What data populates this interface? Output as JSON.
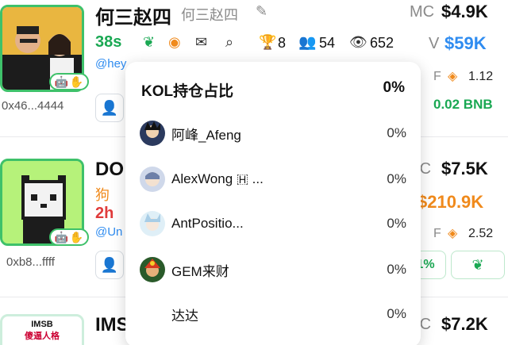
{
  "row1": {
    "name": "何三赵四",
    "name_secondary": "何三赵四",
    "age": "38s",
    "stat_trophy": "8",
    "stat_holders": "54",
    "stat_views": "652",
    "handle": "@hey",
    "addr": "0x46...4444",
    "mc_label": "MC",
    "mc_value": "$4.9K",
    "v_label": "V",
    "v_value": "$59K",
    "f_label": "F",
    "f_value": "1.12",
    "bnb_value": "0.02 BNB"
  },
  "row2": {
    "name": "DO",
    "subname": "狗",
    "age": "2h",
    "handle": "@Un",
    "addr": "0xb8...ffff",
    "mc_label": "MC",
    "mc_value": "$7.5K",
    "v_value": "$210.9K",
    "f_label": "F",
    "f_value": "2.52",
    "pct_value": "1%"
  },
  "row3": {
    "name": "IMS",
    "avatar_text_top": "IMSB",
    "avatar_text_bottom": "傻逼人格",
    "mc_label": "MC",
    "mc_value": "$7.2K"
  },
  "popup": {
    "title": "KOL持仓占比",
    "title_pct": "0%",
    "rows": [
      {
        "name": "阿峰_Afeng",
        "pct": "0%"
      },
      {
        "name": "AlexWong 🇭 ...",
        "pct": "0%"
      },
      {
        "name": "AntPositio...",
        "pct": "0%"
      },
      {
        "name": "GEM来财",
        "pct": "0%"
      },
      {
        "name": "达达",
        "pct": "0%"
      }
    ]
  },
  "colors": {
    "green": "#1aa853",
    "blue": "#2f8cf0",
    "orange": "#f08a1c",
    "red": "#e03b3b"
  }
}
